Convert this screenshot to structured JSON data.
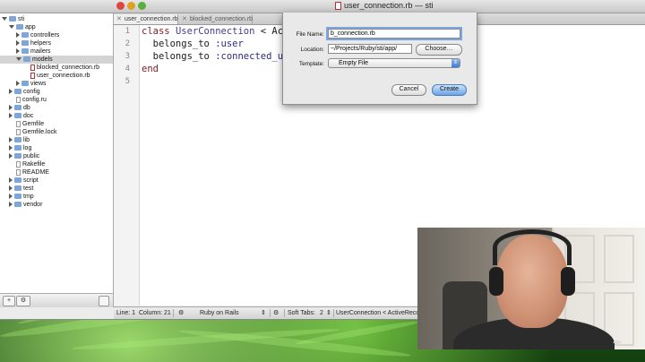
{
  "window": {
    "title": "user_connection.rb — sti"
  },
  "sidebar": {
    "tree": [
      {
        "label": "sti",
        "type": "folder",
        "state": "open",
        "indent": 0
      },
      {
        "label": "app",
        "type": "folder",
        "state": "open",
        "indent": 1
      },
      {
        "label": "controllers",
        "type": "folder",
        "state": "closed",
        "indent": 2
      },
      {
        "label": "helpers",
        "type": "folder",
        "state": "closed",
        "indent": 2
      },
      {
        "label": "mailers",
        "type": "folder",
        "state": "closed",
        "indent": 2
      },
      {
        "label": "models",
        "type": "folder",
        "state": "open",
        "indent": 2,
        "selected": true
      },
      {
        "label": "blocked_connection.rb",
        "type": "file-rb",
        "indent": 3
      },
      {
        "label": "user_connection.rb",
        "type": "file-rb",
        "indent": 3
      },
      {
        "label": "views",
        "type": "folder",
        "state": "closed",
        "indent": 2
      },
      {
        "label": "config",
        "type": "folder",
        "state": "closed",
        "indent": 1
      },
      {
        "label": "config.ru",
        "type": "file",
        "indent": 1
      },
      {
        "label": "db",
        "type": "folder",
        "state": "closed",
        "indent": 1
      },
      {
        "label": "doc",
        "type": "folder",
        "state": "closed",
        "indent": 1
      },
      {
        "label": "Gemfile",
        "type": "file",
        "indent": 1
      },
      {
        "label": "Gemfile.lock",
        "type": "file",
        "indent": 1
      },
      {
        "label": "lib",
        "type": "folder",
        "state": "closed",
        "indent": 1
      },
      {
        "label": "log",
        "type": "folder",
        "state": "closed",
        "indent": 1
      },
      {
        "label": "public",
        "type": "folder",
        "state": "closed",
        "indent": 1
      },
      {
        "label": "Rakefile",
        "type": "file",
        "indent": 1
      },
      {
        "label": "README",
        "type": "file",
        "indent": 1
      },
      {
        "label": "script",
        "type": "folder",
        "state": "closed",
        "indent": 1
      },
      {
        "label": "test",
        "type": "folder",
        "state": "closed",
        "indent": 1
      },
      {
        "label": "tmp",
        "type": "folder",
        "state": "closed",
        "indent": 1
      },
      {
        "label": "vendor",
        "type": "folder",
        "state": "closed",
        "indent": 1
      }
    ],
    "bottom_buttons": [
      "+",
      "⚙"
    ]
  },
  "tabs": [
    {
      "label": "user_connection.rb",
      "active": true
    },
    {
      "label": "blocked_connection.rb",
      "active": false
    }
  ],
  "editor": {
    "line_numbers": [
      "1",
      "2",
      "3",
      "4",
      "5"
    ],
    "lines": [
      [
        {
          "t": "class ",
          "c": "kw"
        },
        {
          "t": "UserConnection",
          "c": "const"
        },
        {
          "t": " < Acti",
          "c": ""
        }
      ],
      [
        {
          "t": "  belongs_to ",
          "c": ""
        },
        {
          "t": ":user",
          "c": "sym"
        }
      ],
      [
        {
          "t": "  belongs_to ",
          "c": ""
        },
        {
          "t": ":connected_us",
          "c": "sym"
        }
      ],
      [
        {
          "t": "end",
          "c": "kw"
        }
      ],
      [
        {
          "t": "",
          "c": ""
        }
      ]
    ]
  },
  "status": {
    "line": "Line: 1",
    "column": "Column: 21",
    "language": "Ruby on Rails",
    "soft_tabs": "Soft Tabs:",
    "tab_size": "2",
    "symbol": "UserConnection < ActiveReco"
  },
  "dialog": {
    "file_name_label": "File Name:",
    "file_name_value": "b_connection.rb",
    "location_label": "Location:",
    "location_value": "~/Projects/Ruby/sti/app/",
    "choose_button": "Choose…",
    "template_label": "Template:",
    "template_value": "Empty File",
    "cancel_button": "Cancel",
    "create_button": "Create"
  },
  "colors": {
    "accent_blue": "#6aa4e8",
    "wallpaper_green": "#2e7a22"
  }
}
